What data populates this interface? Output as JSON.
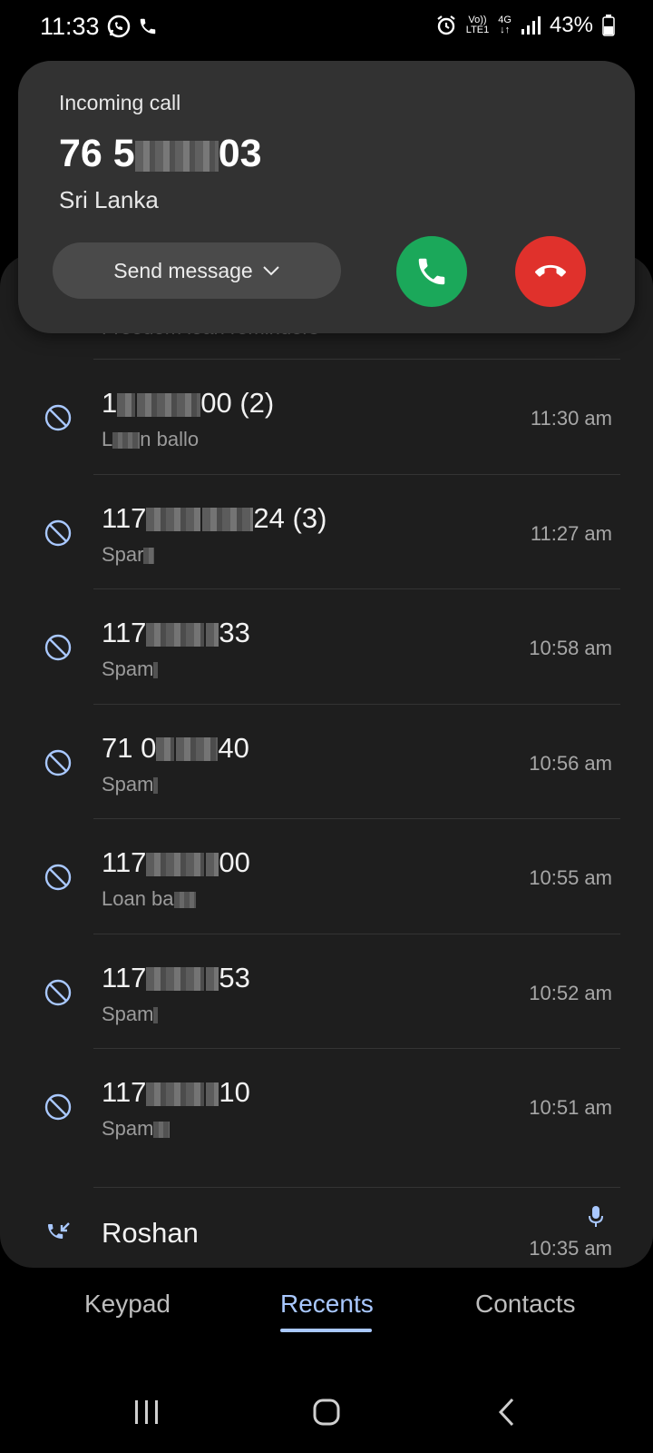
{
  "status_bar": {
    "time": "11:33",
    "volte_label": "Vo))",
    "lte_label": "LTE1",
    "network_label": "4G",
    "battery": "43%"
  },
  "incoming_call": {
    "title": "Incoming call",
    "number_start": "76 5",
    "number_end": "03",
    "country": "Sri Lanka",
    "send_message_label": "Send message"
  },
  "recents": {
    "faded_row_label": "Freedom loan reminders",
    "rows": [
      {
        "number_start": "1",
        "number_end": "00 (2)",
        "label_start": "L",
        "label_end": "n ballo",
        "time": "11:30 am"
      },
      {
        "number_start": "117",
        "number_end": "24 (3)",
        "label_start": "Spar",
        "label_end": "",
        "time": "11:27 am"
      },
      {
        "number_start": "117",
        "number_end": "33",
        "label_start": "Spam",
        "label_end": "",
        "time": "10:58 am"
      },
      {
        "number_start": "71 0",
        "number_end": "40",
        "label_start": "Spam",
        "label_end": "",
        "time": "10:56 am"
      },
      {
        "number_start": "117",
        "number_end": "00",
        "label_start": "Loan ba",
        "label_end": "",
        "time": "10:55 am"
      },
      {
        "number_start": "117",
        "number_end": "53",
        "label_start": "Spam",
        "label_end": "",
        "time": "10:52 am"
      },
      {
        "number_start": "117",
        "number_end": "10",
        "label_start": "Spam",
        "label_end": "",
        "time": "10:51 am"
      }
    ],
    "contact_row": {
      "name": "Roshan",
      "time": "10:35 am"
    }
  },
  "tabs": {
    "keypad": "Keypad",
    "recents": "Recents",
    "contacts": "Contacts",
    "active": "Recents"
  },
  "colors": {
    "accent": "#a9c8ff",
    "accept": "#1ba85a",
    "decline": "#e0312c",
    "panel": "#1e1e1e",
    "card": "#323232"
  },
  "icons": [
    "whatsapp-icon",
    "phone-icon",
    "alarm-icon",
    "signal-icon",
    "battery-icon",
    "block-icon",
    "incoming-call-icon",
    "mic-icon",
    "chevron-down-icon",
    "accept-call-icon",
    "decline-call-icon",
    "recent-apps-icon",
    "home-icon",
    "back-icon"
  ]
}
